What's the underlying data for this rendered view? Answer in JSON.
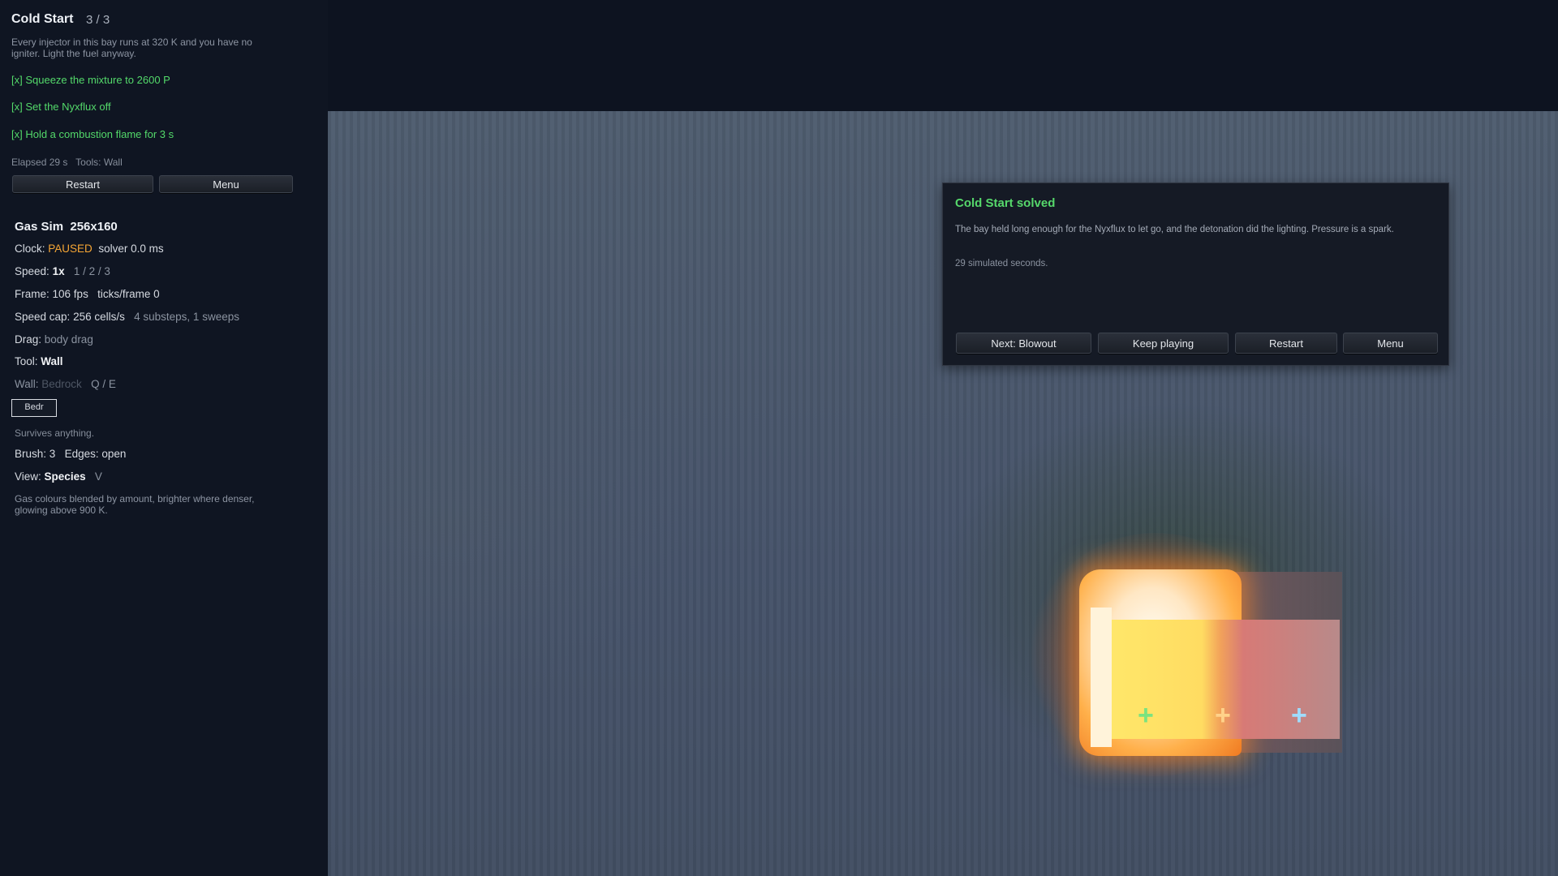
{
  "level": {
    "title": "Cold Start",
    "progress": "3 / 3",
    "description": "Every injector in this bay runs at 320 K and you have no igniter. Light the fuel anyway.",
    "objectives": [
      "[x] Squeeze the mixture to 2600 P",
      "[x] Set the Nyxflux off",
      "[x] Hold a combustion flame for 3 s"
    ],
    "status_line": "Elapsed 29 s   Tools: Wall",
    "restart_label": "Restart",
    "menu_label": "Menu"
  },
  "sim": {
    "title": "Gas Sim",
    "grid": "256x160",
    "clock_label": "Clock:",
    "clock_value": "PAUSED",
    "solver": "solver 0.0 ms",
    "speed_label": "Speed:",
    "speed_value": "1x",
    "speed_options": "1 / 2 / 3",
    "frame_label": "Frame:",
    "frame_value": "106 fps",
    "ticks": "ticks/frame 0",
    "cap_label": "Speed cap:",
    "cap_value": "256 cells/s",
    "cap_detail": "4 substeps, 1 sweeps",
    "drag_label": "Drag:",
    "drag_value": "body drag",
    "tool_label": "Tool:",
    "tool_value": "Wall",
    "wall_label": "Wall:",
    "wall_value": "Bedrock",
    "wall_keys": "Q / E",
    "material_chip": "Bedr",
    "material_desc": "Survives anything.",
    "brush_label": "Brush:",
    "brush_value": "3",
    "edges_label": "Edges:",
    "edges_value": "open",
    "view_label": "View:",
    "view_value": "Species",
    "view_key": "V",
    "view_desc": "Gas colours blended by amount, brighter where denser, glowing above 900 K."
  },
  "dialog": {
    "title": "Cold Start solved",
    "body": "The bay held long enough for the Nyxflux to let go, and the detonation did the lighting. Pressure is a spark.",
    "detail": "29 simulated seconds.",
    "buttons": [
      "Next: Blowout",
      "Keep playing",
      "Restart",
      "Menu"
    ]
  },
  "colors": {
    "accent_green": "#53d96a",
    "paused_orange": "#f5a534",
    "injector_green": "#7be37f",
    "injector_orange": "#ffd28a",
    "injector_blue": "#9fdcff"
  },
  "icons": [
    "plus-marker-icon",
    "plus-marker-icon",
    "plus-marker-icon"
  ]
}
